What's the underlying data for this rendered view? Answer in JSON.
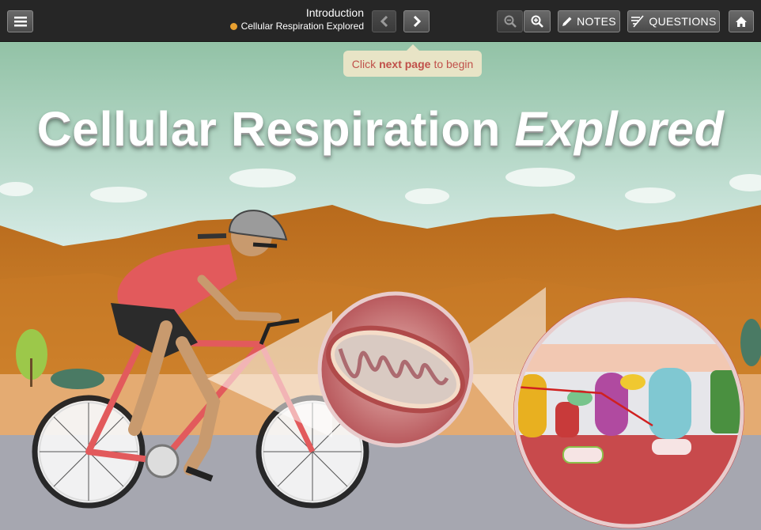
{
  "toolbar": {
    "menu_icon": "hamburger-menu-icon",
    "chapter_title": "Introduction",
    "book_title": "Cellular Respiration Explored",
    "prev_icon": "chevron-left-icon",
    "next_icon": "chevron-right-icon",
    "zoom_out_icon": "zoom-out-icon",
    "zoom_in_icon": "zoom-in-icon",
    "notes_label": "NOTES",
    "questions_label": "QUESTIONS",
    "home_icon": "home-icon"
  },
  "hint": {
    "prefix": "Click",
    "emphasis": "next page",
    "suffix": "to begin"
  },
  "heading": {
    "main": "Cellular Respiration",
    "italic": "Explored"
  },
  "colors": {
    "sky": "#9cc8ae",
    "hills": "#c67822",
    "road": "#a6a7b0",
    "jersey": "#e25a5c",
    "tip_text": "#c0504a"
  }
}
